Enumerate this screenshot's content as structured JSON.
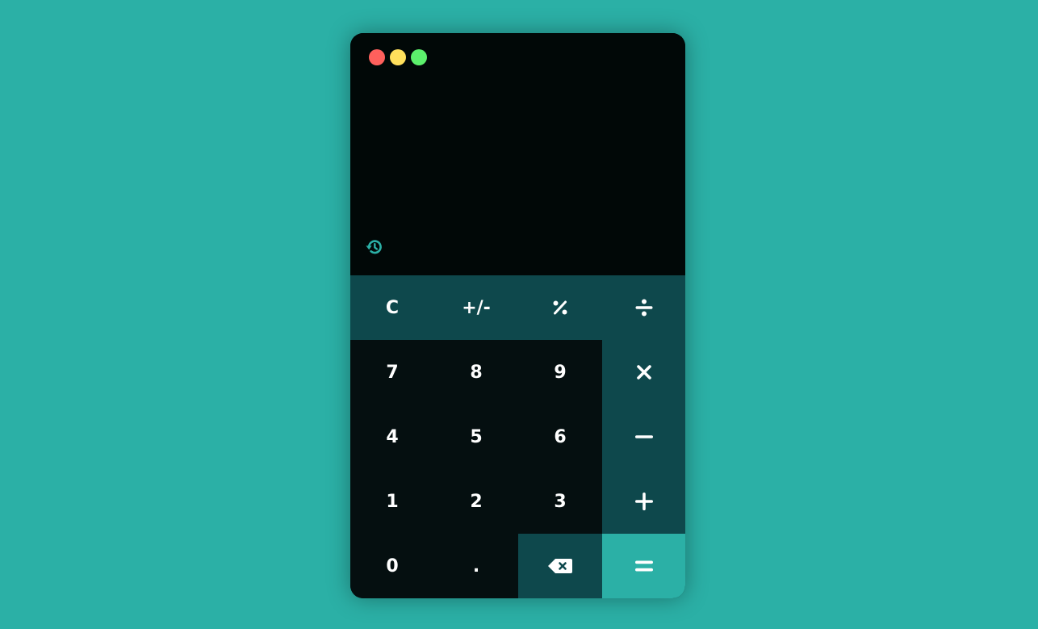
{
  "window": {
    "controls": [
      "close",
      "minimize",
      "maximize"
    ]
  },
  "display": {
    "expression": "",
    "result": "",
    "history_icon": "history-icon"
  },
  "keypad": {
    "clear_label": "C",
    "sign_label": "+/-",
    "percent_icon": "percent-icon",
    "divide_icon": "divide-icon",
    "seven_label": "7",
    "eight_label": "8",
    "nine_label": "9",
    "multiply_icon": "multiply-icon",
    "four_label": "4",
    "five_label": "5",
    "six_label": "6",
    "subtract_icon": "minus-icon",
    "one_label": "1",
    "two_label": "2",
    "three_label": "3",
    "add_icon": "plus-icon",
    "zero_label": "0",
    "decimal_label": ".",
    "backspace_icon": "backspace-icon",
    "equals_icon": "equals-icon"
  },
  "colors": {
    "page_background": "#2bb0a6",
    "display_background": "#010807",
    "number_key": "#050f10",
    "function_key": "#0e484c",
    "equals_key": "#2bb0a6",
    "text": "#ffffff",
    "history_icon": "#2bb0a6",
    "close": "#ff605c",
    "minimize": "#ffe05c",
    "maximize": "#5cf06c"
  }
}
